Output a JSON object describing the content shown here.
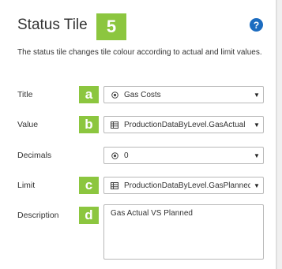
{
  "panel": {
    "title": "Status Tile",
    "step_number": "5",
    "help_icon": "question-circle-icon",
    "description": "The status tile changes tile colour according to actual and limit values."
  },
  "fields": {
    "title": {
      "label": "Title",
      "marker": "a",
      "value": "Gas Costs",
      "icon": "radio-icon"
    },
    "value": {
      "label": "Value",
      "marker": "b",
      "value": "ProductionDataByLevel.GasActual",
      "icon": "table-icon"
    },
    "decimals": {
      "label": "Decimals",
      "value": "0",
      "icon": "radio-icon"
    },
    "limit": {
      "label": "Limit",
      "marker": "c",
      "value": "ProductionDataByLevel.GasPlanned",
      "icon": "table-icon"
    },
    "description": {
      "label": "Description",
      "marker": "d",
      "value": "Gas Actual VS Planned"
    }
  },
  "colors": {
    "marker_green": "#8cc63f",
    "help_blue": "#1c6cc0"
  }
}
